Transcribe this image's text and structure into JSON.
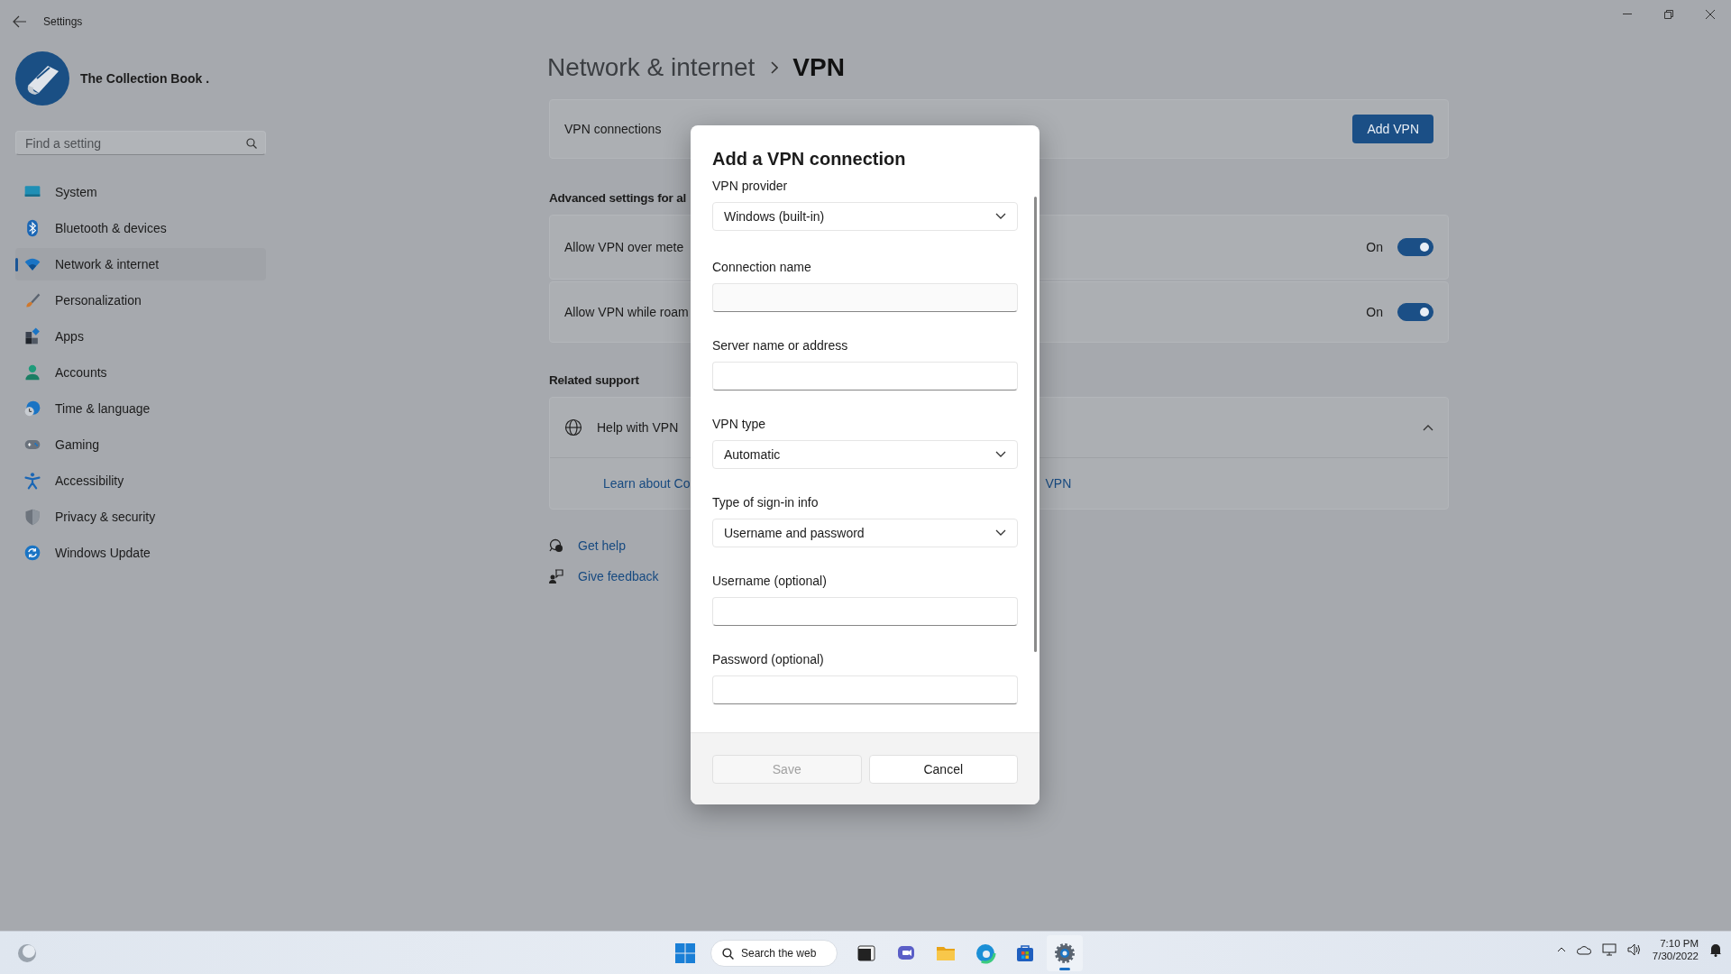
{
  "window": {
    "title": "Settings"
  },
  "profile": {
    "name": "The Collection Book ."
  },
  "search": {
    "placeholder": "Find a setting"
  },
  "sidebar": {
    "items": [
      {
        "label": "System",
        "kind": "system",
        "selected": false
      },
      {
        "label": "Bluetooth & devices",
        "kind": "bluetooth",
        "selected": false
      },
      {
        "label": "Network & internet",
        "kind": "network",
        "selected": true
      },
      {
        "label": "Personalization",
        "kind": "personalization",
        "selected": false
      },
      {
        "label": "Apps",
        "kind": "apps",
        "selected": false
      },
      {
        "label": "Accounts",
        "kind": "accounts",
        "selected": false
      },
      {
        "label": "Time & language",
        "kind": "time",
        "selected": false
      },
      {
        "label": "Gaming",
        "kind": "gaming",
        "selected": false
      },
      {
        "label": "Accessibility",
        "kind": "accessibility",
        "selected": false
      },
      {
        "label": "Privacy & security",
        "kind": "privacy",
        "selected": false
      },
      {
        "label": "Windows Update",
        "kind": "update",
        "selected": false
      }
    ]
  },
  "breadcrumb": [
    "Network & internet",
    "VPN"
  ],
  "vpn_connections": {
    "label": "VPN connections",
    "button": "Add VPN"
  },
  "advanced": {
    "heading": "Advanced settings for al",
    "rows": [
      {
        "label": "Allow VPN over mete",
        "state": "On",
        "on": true
      },
      {
        "label": "Allow VPN while roam",
        "state": "On",
        "on": true
      }
    ]
  },
  "related": {
    "heading": "Related support",
    "help": {
      "label": "Help with VPN",
      "expanded": true,
      "links": [
        "Learn about Co",
        "VPN"
      ]
    }
  },
  "help_links": [
    {
      "label": "Get help",
      "kind": "help"
    },
    {
      "label": "Give feedback",
      "kind": "feedback"
    }
  ],
  "dialog": {
    "title": "Add a VPN connection",
    "fields": [
      {
        "label": "VPN provider",
        "kind": "dropdown",
        "value": "Windows (built-in)"
      },
      {
        "label": "Connection name",
        "kind": "text"
      },
      {
        "label": "Server name or address",
        "kind": "text"
      },
      {
        "label": "VPN type",
        "kind": "dropdown",
        "value": "Automatic"
      },
      {
        "label": "Type of sign-in info",
        "kind": "dropdown",
        "value": "Username and password"
      },
      {
        "label": "Username (optional)",
        "kind": "text"
      },
      {
        "label": "Password (optional)",
        "kind": "text"
      }
    ],
    "buttons": [
      {
        "label": "Save",
        "disabled": true
      },
      {
        "label": "Cancel",
        "disabled": false
      }
    ]
  },
  "taskbar": {
    "search": "Search the web",
    "apps": [
      {
        "kind": "terminal",
        "selected": false
      },
      {
        "kind": "chat",
        "selected": false
      },
      {
        "kind": "folder",
        "selected": false
      },
      {
        "kind": "browser",
        "selected": false
      },
      {
        "kind": "store",
        "selected": false
      },
      {
        "kind": "settings",
        "selected": true
      }
    ],
    "clock": {
      "time": "7:10 PM",
      "date": "7/30/2022"
    }
  }
}
